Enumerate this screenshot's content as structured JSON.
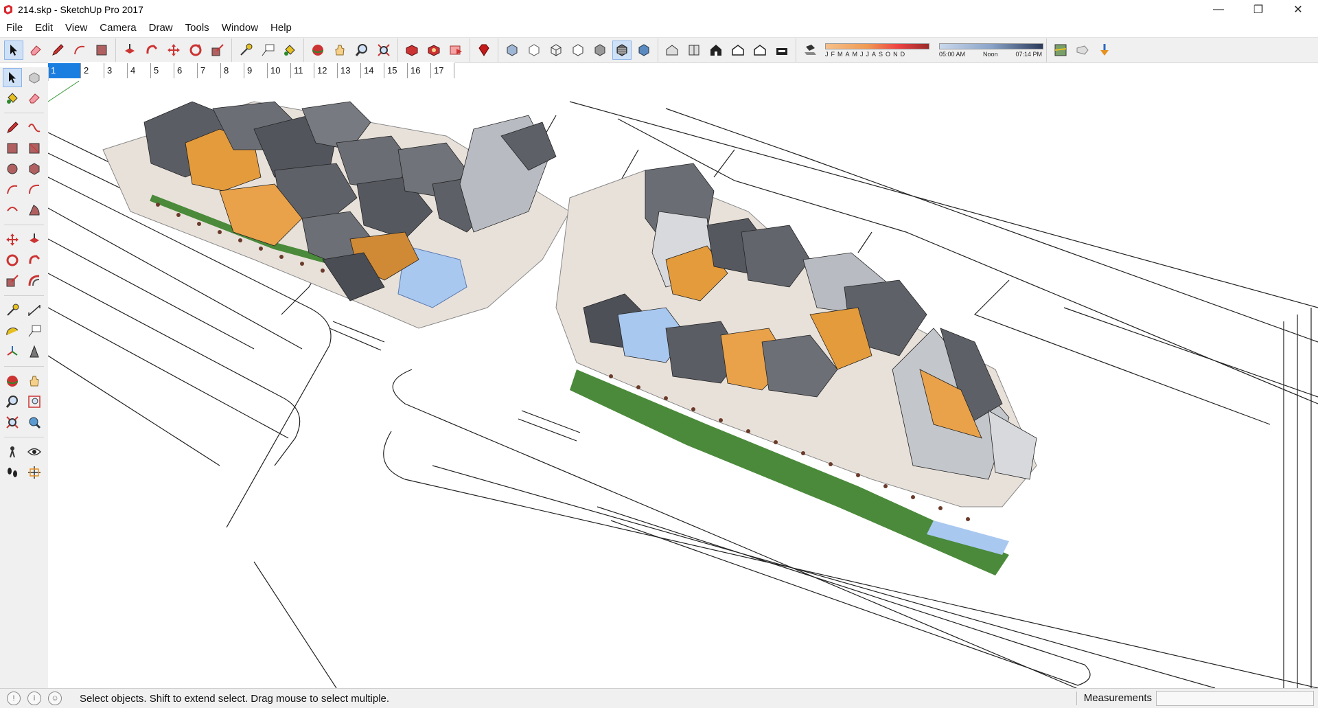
{
  "window": {
    "title": "214.skp - SketchUp Pro 2017",
    "controls": {
      "minimize": "—",
      "restore": "❐",
      "close": "✕"
    }
  },
  "menu": [
    "File",
    "Edit",
    "View",
    "Camera",
    "Draw",
    "Tools",
    "Window",
    "Help"
  ],
  "toolbar": {
    "groups": [
      [
        "select",
        "eraser",
        "pencil",
        "arc",
        "rectangle"
      ],
      [
        "push-pull",
        "follow-me",
        "move",
        "rotate",
        "scale"
      ],
      [
        "tape-measure",
        "text",
        "paint-bucket"
      ],
      [
        "orbit",
        "pan",
        "zoom",
        "zoom-extents"
      ],
      [
        "3d-warehouse",
        "extension-warehouse",
        "send-to-layout"
      ],
      [
        "ruby"
      ],
      [
        "xray",
        "back-edges",
        "wireframe",
        "hidden-line",
        "shaded",
        "textured",
        "monochrome"
      ],
      [
        "iso",
        "top",
        "front",
        "right",
        "back",
        "left"
      ]
    ],
    "shadow": {
      "months": [
        "J",
        "F",
        "M",
        "A",
        "M",
        "J",
        "J",
        "A",
        "S",
        "O",
        "N",
        "D"
      ],
      "time_start": "05:00 AM",
      "time_noon": "Noon",
      "time_end": "07:14 PM"
    }
  },
  "scenes": [
    "1",
    "2",
    "3",
    "4",
    "5",
    "6",
    "7",
    "8",
    "9",
    "10",
    "11",
    "12",
    "13",
    "14",
    "15",
    "16",
    "17"
  ],
  "active_scene": "1",
  "left_tools": [
    [
      "select",
      "component"
    ],
    [
      "paint-bucket",
      "eraser"
    ],
    [
      "pencil",
      "freehand"
    ],
    [
      "rectangle",
      "rotated-rectangle"
    ],
    [
      "circle",
      "polygon"
    ],
    [
      "arc",
      "2pt-arc"
    ],
    [
      "3pt-arc",
      "pie"
    ],
    [
      "move",
      "push-pull"
    ],
    [
      "rotate",
      "follow-me"
    ],
    [
      "scale",
      "offset"
    ],
    [
      "tape-measure",
      "dimension"
    ],
    [
      "protractor",
      "text"
    ],
    [
      "axes",
      "3d-text"
    ],
    [
      "orbit",
      "pan"
    ],
    [
      "zoom",
      "zoom-window"
    ],
    [
      "zoom-extents",
      "previous"
    ],
    [
      "position-camera",
      "look-around"
    ],
    [
      "walk",
      "section-plane"
    ]
  ],
  "status": {
    "message": "Select objects. Shift to extend select. Drag mouse to select multiple.",
    "measurements_label": "Measurements",
    "measurements_value": ""
  }
}
